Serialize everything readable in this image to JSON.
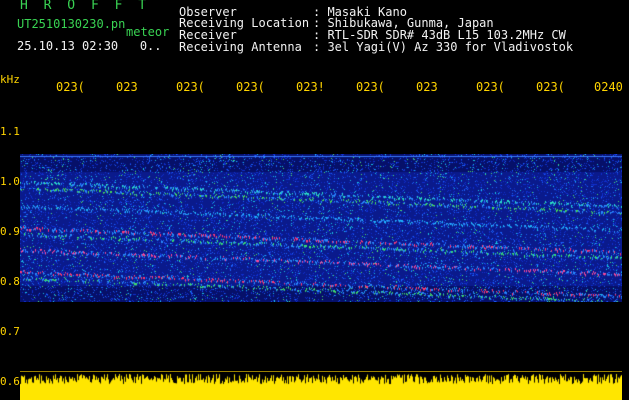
{
  "header": {
    "logo": "H R O F F T",
    "filename": "UT2510130230.pn",
    "meteor_label": "meteor",
    "datetime": "25.10.13 02:30   0.."
  },
  "info": {
    "rows": [
      {
        "label": "Observer",
        "value": ": Masaki Kano"
      },
      {
        "label": "Receiving Location",
        "value": ": Shibukawa, Gunma, Japan"
      },
      {
        "label": "Receiver",
        "value": ": RTL-SDR SDR# 43dB L15 103.2MHz CW"
      },
      {
        "label": "Receiving Antenna",
        "value": ": 3el Yagi(V) Az 330 for Vladivostok"
      }
    ]
  },
  "axis": {
    "unit": "kHz",
    "x_ticks": [
      "023(",
      "023",
      "023(",
      "023(",
      "023!",
      "023(",
      "023",
      "023(",
      "023(",
      "0240"
    ],
    "y_ticks": [
      "1.1",
      "1.0",
      "0.9",
      "0.8",
      "0.7",
      "0.6"
    ]
  },
  "colors": {
    "text_green": "#39d353",
    "text_white": "#f2f2f2",
    "axis_yellow": "#ffd400",
    "background": "#000000"
  }
}
